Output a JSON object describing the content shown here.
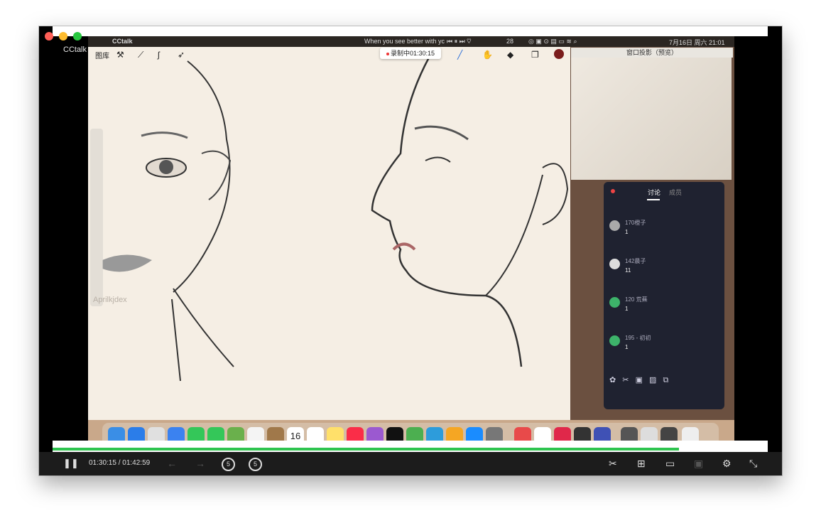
{
  "window": {
    "app_name": "CCtalk"
  },
  "menubar": {
    "app": "CCtalk",
    "now_playing": "When you see better with yc",
    "badge_count": "28",
    "datetime": "7月16日 周六 21:01"
  },
  "recording": {
    "label": "录制中01:30:15"
  },
  "canvas": {
    "gallery_label": "图库",
    "watermark": "Aprilkjdex"
  },
  "preview": {
    "title": "窗口投影（预览）"
  },
  "chat": {
    "tabs": [
      "讨论",
      "成员"
    ],
    "messages": [
      {
        "name": "170橙子",
        "text": "1"
      },
      {
        "name": "142晨子",
        "text": "11"
      },
      {
        "name": "120 荒蕪",
        "text": "1"
      },
      {
        "name": "195 - 初初",
        "text": "1"
      }
    ]
  },
  "dock": {
    "calendar_date": "16"
  },
  "player": {
    "current_time": "01:30:15",
    "total_time": "01:42:59",
    "time_separator": "/",
    "rewind_seconds": "5",
    "forward_seconds": "5",
    "progress": 0.876
  },
  "colors": {
    "progress": "#2ec44f",
    "accent_red": "#fe5f57"
  }
}
